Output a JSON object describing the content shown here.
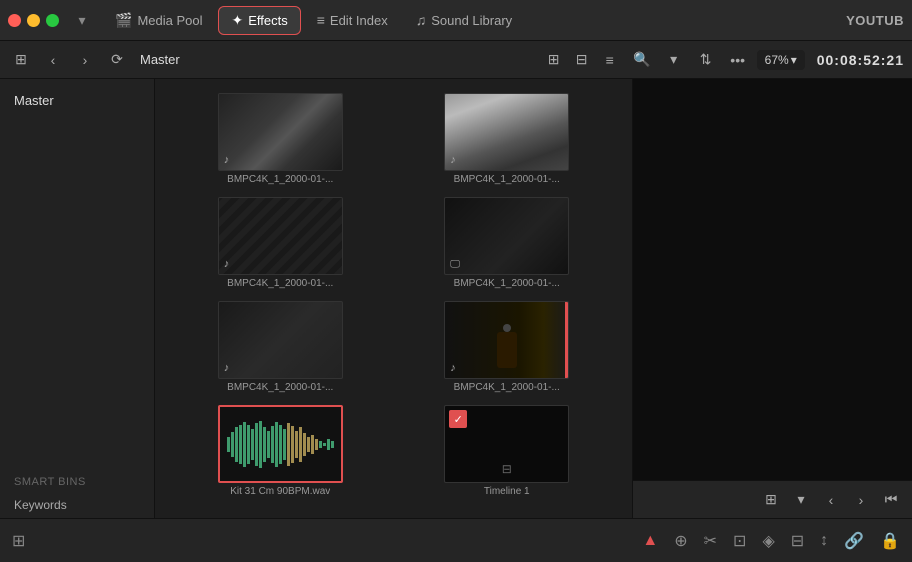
{
  "topbar": {
    "tabs": [
      {
        "id": "media-pool",
        "label": "Media Pool",
        "icon": "🎬",
        "active": false
      },
      {
        "id": "effects",
        "label": "Effects",
        "icon": "✦",
        "active": true
      },
      {
        "id": "edit-index",
        "label": "Edit Index",
        "icon": "≡",
        "active": false
      },
      {
        "id": "sound-library",
        "label": "Sound Library",
        "icon": "♪",
        "active": false
      }
    ],
    "right_label": "YOUTUB"
  },
  "secondbar": {
    "master_label": "Master",
    "zoom": "67%",
    "timecode": "00:08:52:21"
  },
  "sidebar": {
    "master": "Master",
    "smart_bins_label": "Smart Bins",
    "items": [
      {
        "label": "Keywords"
      }
    ]
  },
  "media_items": [
    {
      "id": 1,
      "filename": "BMPC4K_1_2000-01-...",
      "type": "video",
      "thumb_class": "thumb-1",
      "has_music": true
    },
    {
      "id": 2,
      "filename": "BMPC4K_1_2000-01-...",
      "type": "video",
      "thumb_class": "thumb-2",
      "has_music": true
    },
    {
      "id": 3,
      "filename": "BMPC4K_1_2000-01-...",
      "type": "video",
      "thumb_class": "thumb-3",
      "has_music": true
    },
    {
      "id": 4,
      "filename": "BMPC4K_1_2000-01-...",
      "type": "video",
      "thumb_class": "thumb-4",
      "has_monitor": true
    },
    {
      "id": 5,
      "filename": "BMPC4K_1_2000-01-...",
      "type": "video",
      "thumb_class": "thumb-5",
      "has_music": true
    },
    {
      "id": 6,
      "filename": "BMPC4K_1_2000-01-...",
      "type": "video",
      "thumb_class": "thumb-6",
      "has_music": true
    },
    {
      "id": 7,
      "filename": "Kit 31 Cm 90BPM.wav",
      "type": "audio",
      "selected": true
    },
    {
      "id": 8,
      "filename": "Timeline 1",
      "type": "timeline"
    }
  ],
  "bottom_bar": {
    "icons": [
      "⊞",
      "◁",
      "▷",
      "◈",
      "⊕",
      "⊡",
      "⊟",
      "↺",
      "🔗",
      "🔒"
    ]
  }
}
